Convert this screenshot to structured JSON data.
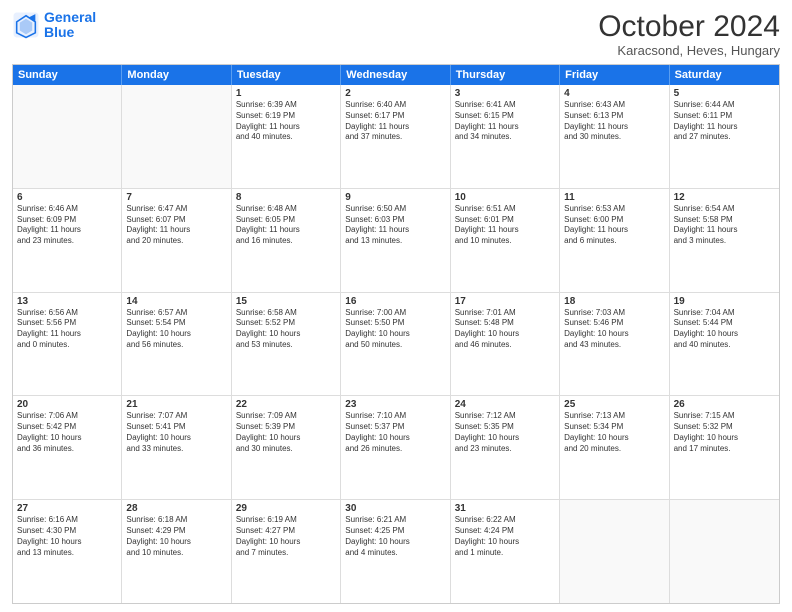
{
  "logo": {
    "line1": "General",
    "line2": "Blue"
  },
  "title": "October 2024",
  "subtitle": "Karacsond, Heves, Hungary",
  "days": [
    "Sunday",
    "Monday",
    "Tuesday",
    "Wednesday",
    "Thursday",
    "Friday",
    "Saturday"
  ],
  "rows": [
    [
      {
        "num": "",
        "lines": []
      },
      {
        "num": "",
        "lines": []
      },
      {
        "num": "1",
        "lines": [
          "Sunrise: 6:39 AM",
          "Sunset: 6:19 PM",
          "Daylight: 11 hours",
          "and 40 minutes."
        ]
      },
      {
        "num": "2",
        "lines": [
          "Sunrise: 6:40 AM",
          "Sunset: 6:17 PM",
          "Daylight: 11 hours",
          "and 37 minutes."
        ]
      },
      {
        "num": "3",
        "lines": [
          "Sunrise: 6:41 AM",
          "Sunset: 6:15 PM",
          "Daylight: 11 hours",
          "and 34 minutes."
        ]
      },
      {
        "num": "4",
        "lines": [
          "Sunrise: 6:43 AM",
          "Sunset: 6:13 PM",
          "Daylight: 11 hours",
          "and 30 minutes."
        ]
      },
      {
        "num": "5",
        "lines": [
          "Sunrise: 6:44 AM",
          "Sunset: 6:11 PM",
          "Daylight: 11 hours",
          "and 27 minutes."
        ]
      }
    ],
    [
      {
        "num": "6",
        "lines": [
          "Sunrise: 6:46 AM",
          "Sunset: 6:09 PM",
          "Daylight: 11 hours",
          "and 23 minutes."
        ]
      },
      {
        "num": "7",
        "lines": [
          "Sunrise: 6:47 AM",
          "Sunset: 6:07 PM",
          "Daylight: 11 hours",
          "and 20 minutes."
        ]
      },
      {
        "num": "8",
        "lines": [
          "Sunrise: 6:48 AM",
          "Sunset: 6:05 PM",
          "Daylight: 11 hours",
          "and 16 minutes."
        ]
      },
      {
        "num": "9",
        "lines": [
          "Sunrise: 6:50 AM",
          "Sunset: 6:03 PM",
          "Daylight: 11 hours",
          "and 13 minutes."
        ]
      },
      {
        "num": "10",
        "lines": [
          "Sunrise: 6:51 AM",
          "Sunset: 6:01 PM",
          "Daylight: 11 hours",
          "and 10 minutes."
        ]
      },
      {
        "num": "11",
        "lines": [
          "Sunrise: 6:53 AM",
          "Sunset: 6:00 PM",
          "Daylight: 11 hours",
          "and 6 minutes."
        ]
      },
      {
        "num": "12",
        "lines": [
          "Sunrise: 6:54 AM",
          "Sunset: 5:58 PM",
          "Daylight: 11 hours",
          "and 3 minutes."
        ]
      }
    ],
    [
      {
        "num": "13",
        "lines": [
          "Sunrise: 6:56 AM",
          "Sunset: 5:56 PM",
          "Daylight: 11 hours",
          "and 0 minutes."
        ]
      },
      {
        "num": "14",
        "lines": [
          "Sunrise: 6:57 AM",
          "Sunset: 5:54 PM",
          "Daylight: 10 hours",
          "and 56 minutes."
        ]
      },
      {
        "num": "15",
        "lines": [
          "Sunrise: 6:58 AM",
          "Sunset: 5:52 PM",
          "Daylight: 10 hours",
          "and 53 minutes."
        ]
      },
      {
        "num": "16",
        "lines": [
          "Sunrise: 7:00 AM",
          "Sunset: 5:50 PM",
          "Daylight: 10 hours",
          "and 50 minutes."
        ]
      },
      {
        "num": "17",
        "lines": [
          "Sunrise: 7:01 AM",
          "Sunset: 5:48 PM",
          "Daylight: 10 hours",
          "and 46 minutes."
        ]
      },
      {
        "num": "18",
        "lines": [
          "Sunrise: 7:03 AM",
          "Sunset: 5:46 PM",
          "Daylight: 10 hours",
          "and 43 minutes."
        ]
      },
      {
        "num": "19",
        "lines": [
          "Sunrise: 7:04 AM",
          "Sunset: 5:44 PM",
          "Daylight: 10 hours",
          "and 40 minutes."
        ]
      }
    ],
    [
      {
        "num": "20",
        "lines": [
          "Sunrise: 7:06 AM",
          "Sunset: 5:42 PM",
          "Daylight: 10 hours",
          "and 36 minutes."
        ]
      },
      {
        "num": "21",
        "lines": [
          "Sunrise: 7:07 AM",
          "Sunset: 5:41 PM",
          "Daylight: 10 hours",
          "and 33 minutes."
        ]
      },
      {
        "num": "22",
        "lines": [
          "Sunrise: 7:09 AM",
          "Sunset: 5:39 PM",
          "Daylight: 10 hours",
          "and 30 minutes."
        ]
      },
      {
        "num": "23",
        "lines": [
          "Sunrise: 7:10 AM",
          "Sunset: 5:37 PM",
          "Daylight: 10 hours",
          "and 26 minutes."
        ]
      },
      {
        "num": "24",
        "lines": [
          "Sunrise: 7:12 AM",
          "Sunset: 5:35 PM",
          "Daylight: 10 hours",
          "and 23 minutes."
        ]
      },
      {
        "num": "25",
        "lines": [
          "Sunrise: 7:13 AM",
          "Sunset: 5:34 PM",
          "Daylight: 10 hours",
          "and 20 minutes."
        ]
      },
      {
        "num": "26",
        "lines": [
          "Sunrise: 7:15 AM",
          "Sunset: 5:32 PM",
          "Daylight: 10 hours",
          "and 17 minutes."
        ]
      }
    ],
    [
      {
        "num": "27",
        "lines": [
          "Sunrise: 6:16 AM",
          "Sunset: 4:30 PM",
          "Daylight: 10 hours",
          "and 13 minutes."
        ]
      },
      {
        "num": "28",
        "lines": [
          "Sunrise: 6:18 AM",
          "Sunset: 4:29 PM",
          "Daylight: 10 hours",
          "and 10 minutes."
        ]
      },
      {
        "num": "29",
        "lines": [
          "Sunrise: 6:19 AM",
          "Sunset: 4:27 PM",
          "Daylight: 10 hours",
          "and 7 minutes."
        ]
      },
      {
        "num": "30",
        "lines": [
          "Sunrise: 6:21 AM",
          "Sunset: 4:25 PM",
          "Daylight: 10 hours",
          "and 4 minutes."
        ]
      },
      {
        "num": "31",
        "lines": [
          "Sunrise: 6:22 AM",
          "Sunset: 4:24 PM",
          "Daylight: 10 hours",
          "and 1 minute."
        ]
      },
      {
        "num": "",
        "lines": []
      },
      {
        "num": "",
        "lines": []
      }
    ]
  ]
}
